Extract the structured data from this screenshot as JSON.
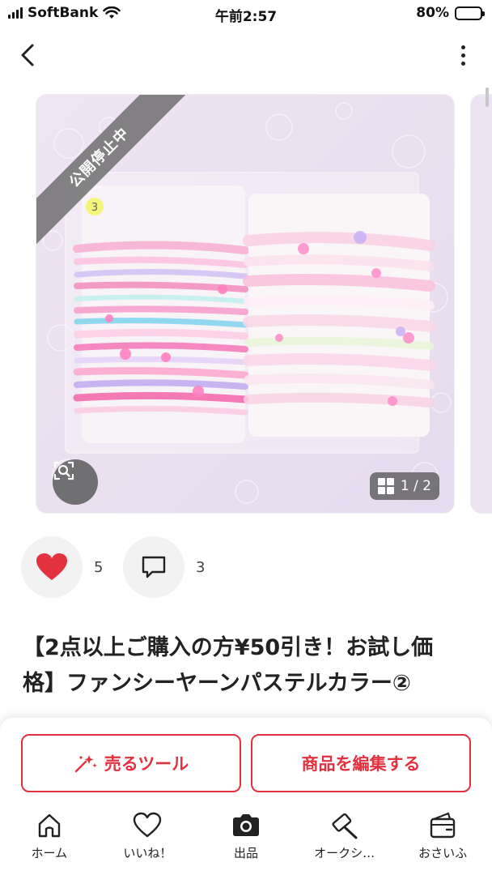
{
  "status_bar": {
    "carrier": "SoftBank",
    "time": "午前2:57",
    "battery_text": "80%",
    "battery_level": 0.8
  },
  "header": {
    "back_icon": "chevron-left-icon",
    "more_icon": "vertical-ellipsis-icon"
  },
  "gallery": {
    "status_ribbon": "公開停止中",
    "page_indicator": "1 / 2",
    "current_page": 1,
    "total_pages": 2,
    "zoom_icon": "image-search-icon",
    "product_note": "3"
  },
  "actions": {
    "like_count": "5",
    "comment_count": "3",
    "like_color": "#e2313f"
  },
  "item": {
    "title": "【2点以上ご購入の方¥50引き！お試し価格】ファンシーヤーンパステルカラー②"
  },
  "bottom_bar": {
    "sell_tool_label": "売るツール",
    "edit_item_label": "商品を編集する",
    "accent_color": "#e2313f"
  },
  "tabs": [
    {
      "label": "ホーム",
      "icon": "home-icon"
    },
    {
      "label": "いいね！",
      "icon": "heart-icon"
    },
    {
      "label": "出品",
      "icon": "camera-icon"
    },
    {
      "label": "オークシ…",
      "icon": "auction-hammer-icon"
    },
    {
      "label": "おさいふ",
      "icon": "wallet-icon"
    }
  ]
}
